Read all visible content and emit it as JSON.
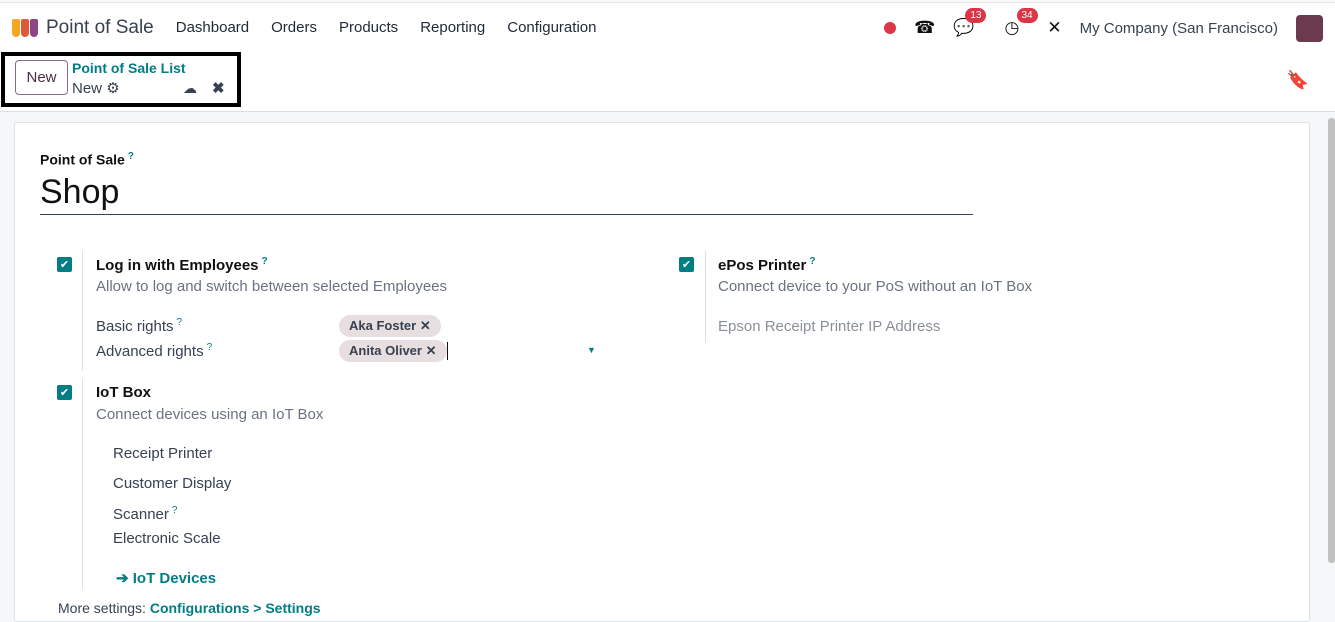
{
  "nav": {
    "app": "Point of Sale",
    "menu": [
      "Dashboard",
      "Orders",
      "Products",
      "Reporting",
      "Configuration"
    ],
    "messages_count": "13",
    "activities_count": "34",
    "company": "My Company (San Francisco)"
  },
  "control": {
    "new_button": "New",
    "breadcrumb": "Point of Sale List",
    "record": "New"
  },
  "form": {
    "name_label": "Point of Sale",
    "name_value": "Shop",
    "employees": {
      "title": "Log in with Employees",
      "desc": "Allow to log and switch between selected Employees",
      "basic_label": "Basic rights",
      "basic_tag": "Aka Foster",
      "advanced_label": "Advanced rights",
      "advanced_tag": "Anita Oliver"
    },
    "epos": {
      "title": "ePos Printer",
      "desc": "Connect device to your PoS without an IoT Box",
      "ip_label": "Epson Receipt Printer IP Address"
    },
    "iot": {
      "title": "IoT Box",
      "desc": "Connect devices using an IoT Box",
      "items": [
        "Receipt Printer",
        "Customer Display",
        "Scanner",
        "Electronic Scale"
      ],
      "link": "IoT Devices"
    },
    "more_label": "More settings:",
    "more_link": "Configurations > Settings"
  },
  "colors": {
    "accent": "#017e84",
    "badge": "#dc3545"
  }
}
